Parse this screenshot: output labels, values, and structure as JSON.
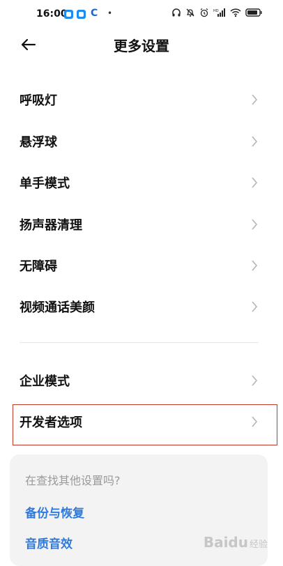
{
  "status_bar": {
    "time": "16:00",
    "c_icon": "C",
    "dot": "•",
    "icons": [
      "headphones-icon",
      "bell-off-icon",
      "alarm-icon",
      "hd-signal-icon",
      "wifi-icon",
      "battery-icon"
    ]
  },
  "header": {
    "title": "更多设置",
    "back_icon": "arrow-left-icon"
  },
  "items": [
    {
      "label": "呼吸灯"
    },
    {
      "label": "悬浮球"
    },
    {
      "label": "单手模式"
    },
    {
      "label": "扬声器清理"
    },
    {
      "label": "无障碍"
    },
    {
      "label": "视频通话美颜"
    },
    {
      "label": "企业模式"
    },
    {
      "label": "开发者选项"
    }
  ],
  "search_card": {
    "title": "在查找其他设置吗?",
    "links": [
      "备份与恢复",
      "音质音效"
    ]
  },
  "watermark": {
    "text": "Baidu",
    "sub": "经验"
  },
  "colors": {
    "accent": "#2f7ad9",
    "highlight": "#c0392b",
    "badge": "#1c8cf0"
  }
}
